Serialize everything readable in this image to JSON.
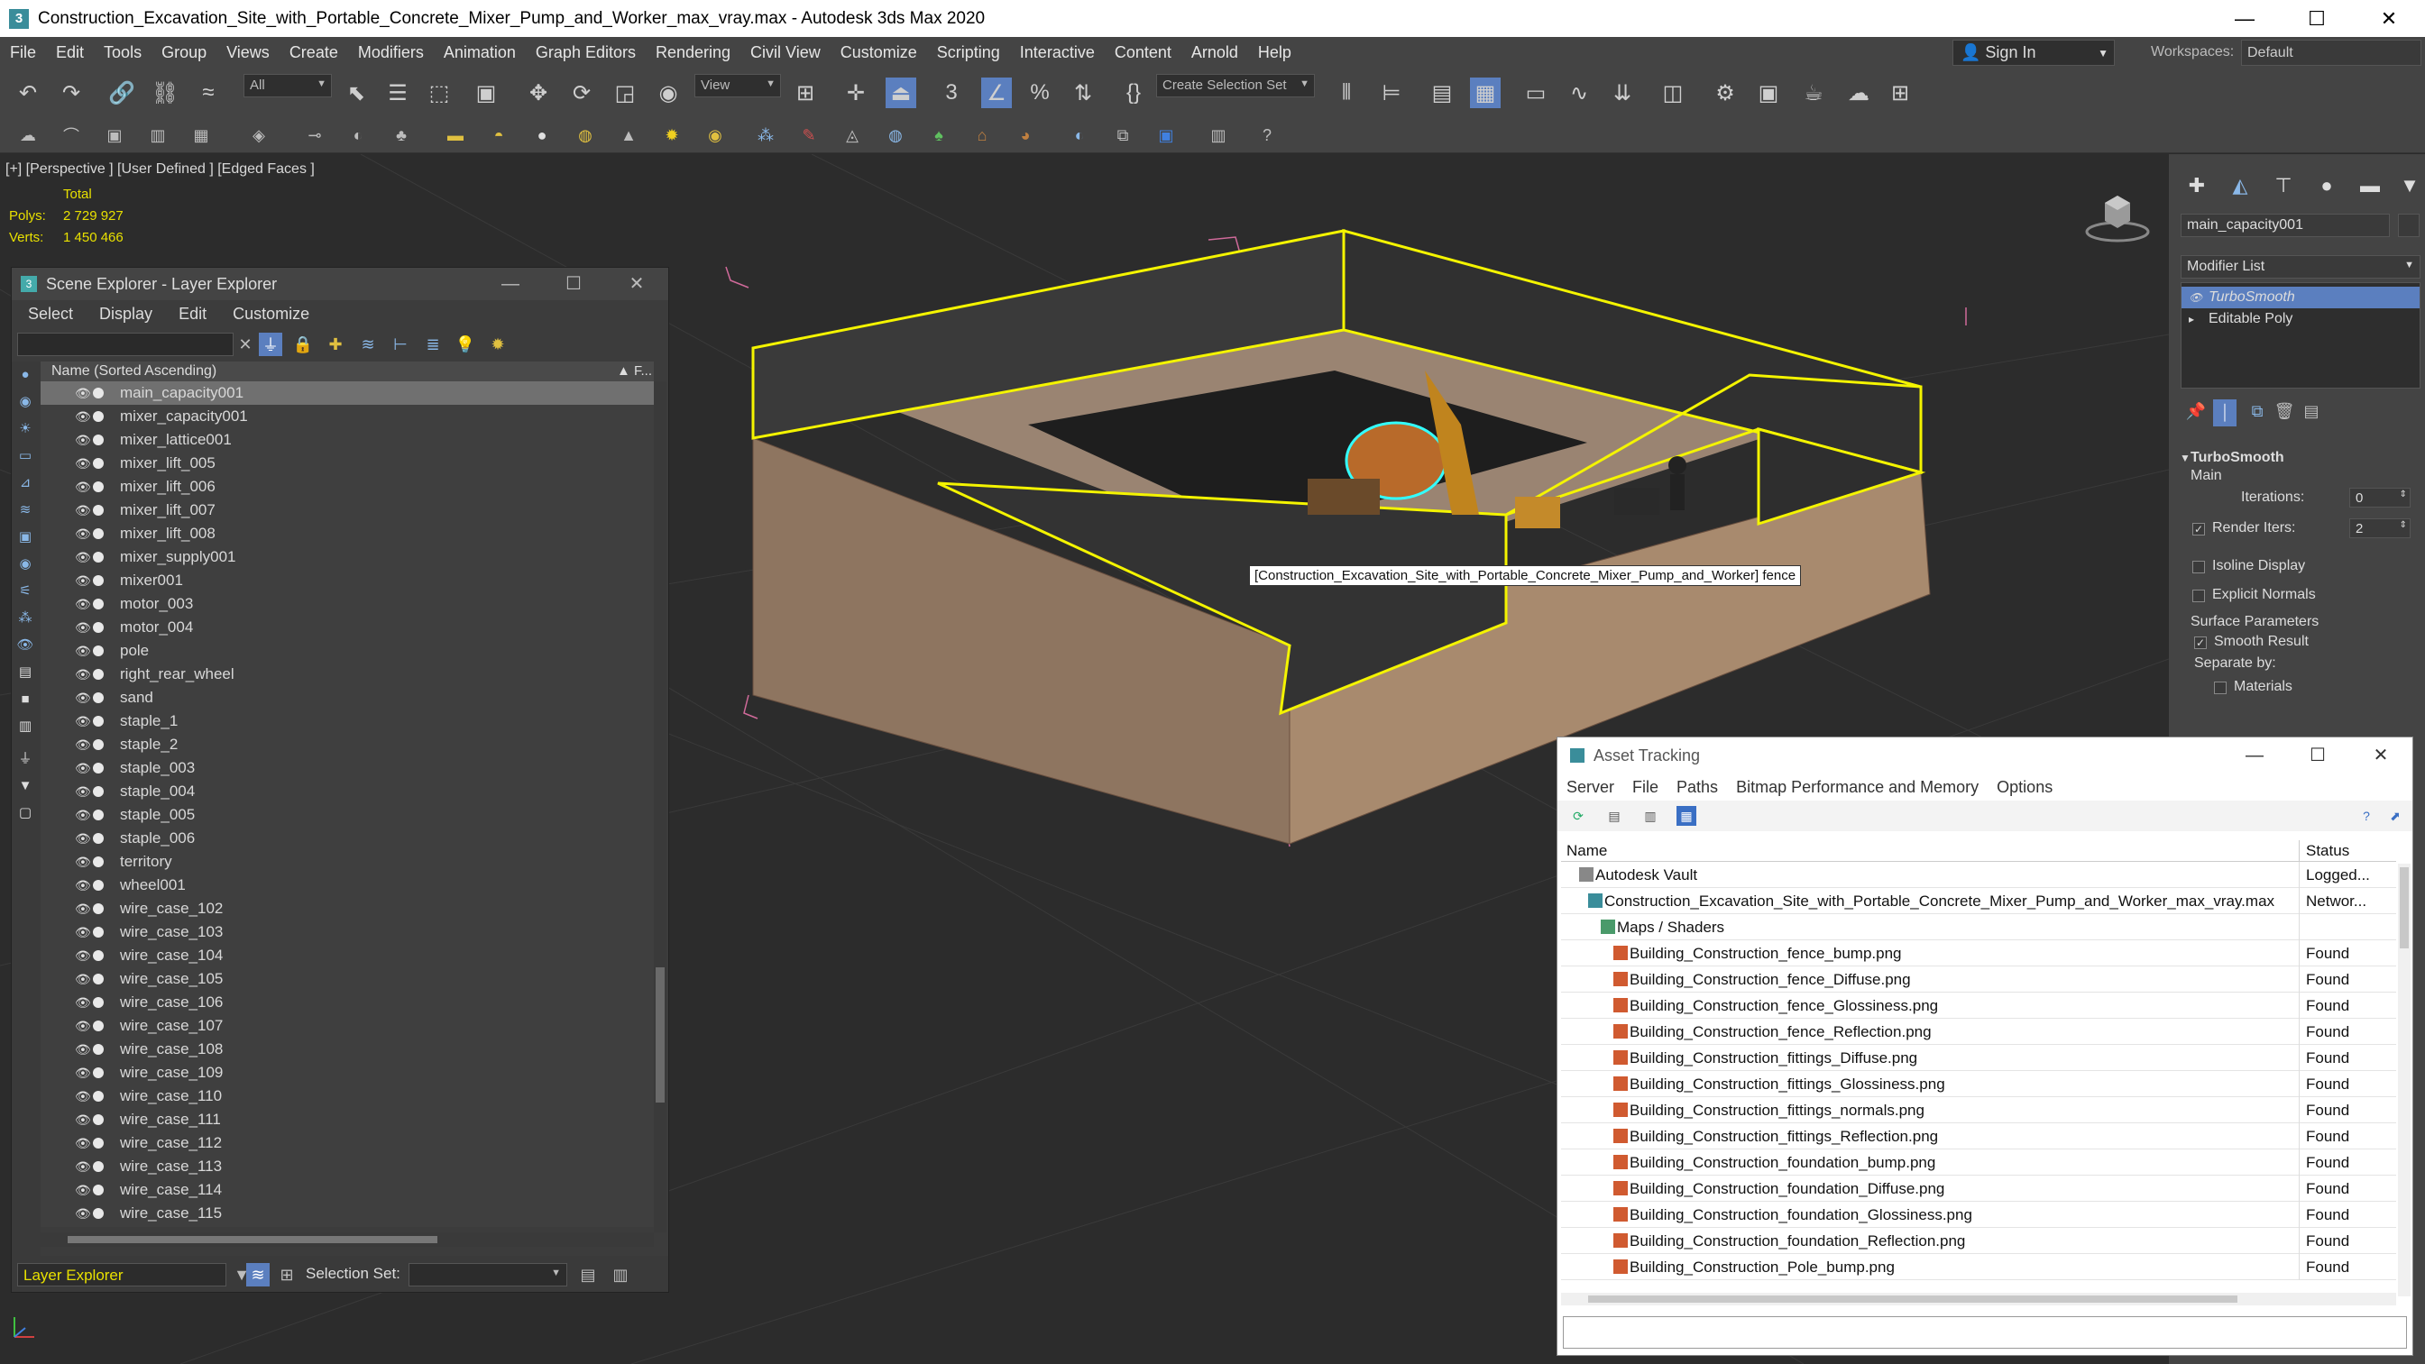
{
  "window": {
    "title": "Construction_Excavation_Site_with_Portable_Concrete_Mixer_Pump_and_Worker_max_vray.max - Autodesk 3ds Max 2020",
    "minimize": "—",
    "maximize": "☐",
    "close": "✕"
  },
  "menu": [
    "File",
    "Edit",
    "Tools",
    "Group",
    "Views",
    "Create",
    "Modifiers",
    "Animation",
    "Graph Editors",
    "Rendering",
    "Civil View",
    "Customize",
    "Scripting",
    "Interactive",
    "Content",
    "Arnold",
    "Help"
  ],
  "signin": {
    "label": "Sign In"
  },
  "workspaces": {
    "label": "Workspaces:",
    "value": "Default"
  },
  "toolbar": {
    "filter_value": "All",
    "refcoord_value": "View",
    "selection_set_value": "Create Selection Set"
  },
  "viewport": {
    "label": "[+] [Perspective ] [User Defined ] [Edged Faces ]",
    "stats_total": "Total",
    "polys_label": "Polys:",
    "polys_value": "2 729 927",
    "verts_label": "Verts:",
    "verts_value": "1 450 466",
    "tooltip": "[Construction_Excavation_Site_with_Portable_Concrete_Mixer_Pump_and_Worker] fence"
  },
  "scene_explorer": {
    "title": "Scene Explorer - Layer Explorer",
    "menu": [
      "Select",
      "Display",
      "Edit",
      "Customize"
    ],
    "column_header": "Name (Sorted Ascending)",
    "column_f": "▲ F...",
    "items": [
      "main_capacity001",
      "mixer_capacity001",
      "mixer_lattice001",
      "mixer_lift_005",
      "mixer_lift_006",
      "mixer_lift_007",
      "mixer_lift_008",
      "mixer_supply001",
      "mixer001",
      "motor_003",
      "motor_004",
      "pole",
      "right_rear_wheel",
      "sand",
      "staple_1",
      "staple_2",
      "staple_003",
      "staple_004",
      "staple_005",
      "staple_006",
      "territory",
      "wheel001",
      "wire_case_102",
      "wire_case_103",
      "wire_case_104",
      "wire_case_105",
      "wire_case_106",
      "wire_case_107",
      "wire_case_108",
      "wire_case_109",
      "wire_case_110",
      "wire_case_111",
      "wire_case_112",
      "wire_case_113",
      "wire_case_114",
      "wire_case_115"
    ],
    "explorer_name": "Layer Explorer",
    "selection_set_label": "Selection Set:"
  },
  "command_panel": {
    "object_name": "main_capacity001",
    "modifier_list": "Modifier List",
    "stack": [
      "TurboSmooth",
      "Editable Poly"
    ],
    "rollout_title": "TurboSmooth",
    "main_label": "Main",
    "iterations_label": "Iterations:",
    "iterations_value": "0",
    "render_iters_label": "Render Iters:",
    "render_iters_value": "2",
    "isoline": "Isoline Display",
    "explicit_normals": "Explicit Normals",
    "surface_params": "Surface Parameters",
    "smooth_result": "Smooth Result",
    "separate_by": "Separate by:",
    "materials": "Materials"
  },
  "asset_tracking": {
    "title": "Asset Tracking",
    "menu": [
      "Server",
      "File",
      "Paths",
      "Bitmap Performance and Memory",
      "Options"
    ],
    "col_name": "Name",
    "col_status": "Status",
    "rows": [
      {
        "name": "Autodesk Vault",
        "status": "Logged..."
      },
      {
        "name": "Construction_Excavation_Site_with_Portable_Concrete_Mixer_Pump_and_Worker_max_vray.max",
        "status": "Networ..."
      },
      {
        "name": "Maps / Shaders",
        "status": ""
      },
      {
        "name": "Building_Construction_fence_bump.png",
        "status": "Found"
      },
      {
        "name": "Building_Construction_fence_Diffuse.png",
        "status": "Found"
      },
      {
        "name": "Building_Construction_fence_Glossiness.png",
        "status": "Found"
      },
      {
        "name": "Building_Construction_fence_Reflection.png",
        "status": "Found"
      },
      {
        "name": "Building_Construction_fittings_Diffuse.png",
        "status": "Found"
      },
      {
        "name": "Building_Construction_fittings_Glossiness.png",
        "status": "Found"
      },
      {
        "name": "Building_Construction_fittings_normals.png",
        "status": "Found"
      },
      {
        "name": "Building_Construction_fittings_Reflection.png",
        "status": "Found"
      },
      {
        "name": "Building_Construction_foundation_bump.png",
        "status": "Found"
      },
      {
        "name": "Building_Construction_foundation_Diffuse.png",
        "status": "Found"
      },
      {
        "name": "Building_Construction_foundation_Glossiness.png",
        "status": "Found"
      },
      {
        "name": "Building_Construction_foundation_Reflection.png",
        "status": "Found"
      },
      {
        "name": "Building_Construction_Pole_bump.png",
        "status": "Found"
      }
    ]
  },
  "colors": {
    "accent_selection": "#5b7fbf",
    "stats_yellow": "#e8e000",
    "selection_outline": "#f4f400"
  }
}
